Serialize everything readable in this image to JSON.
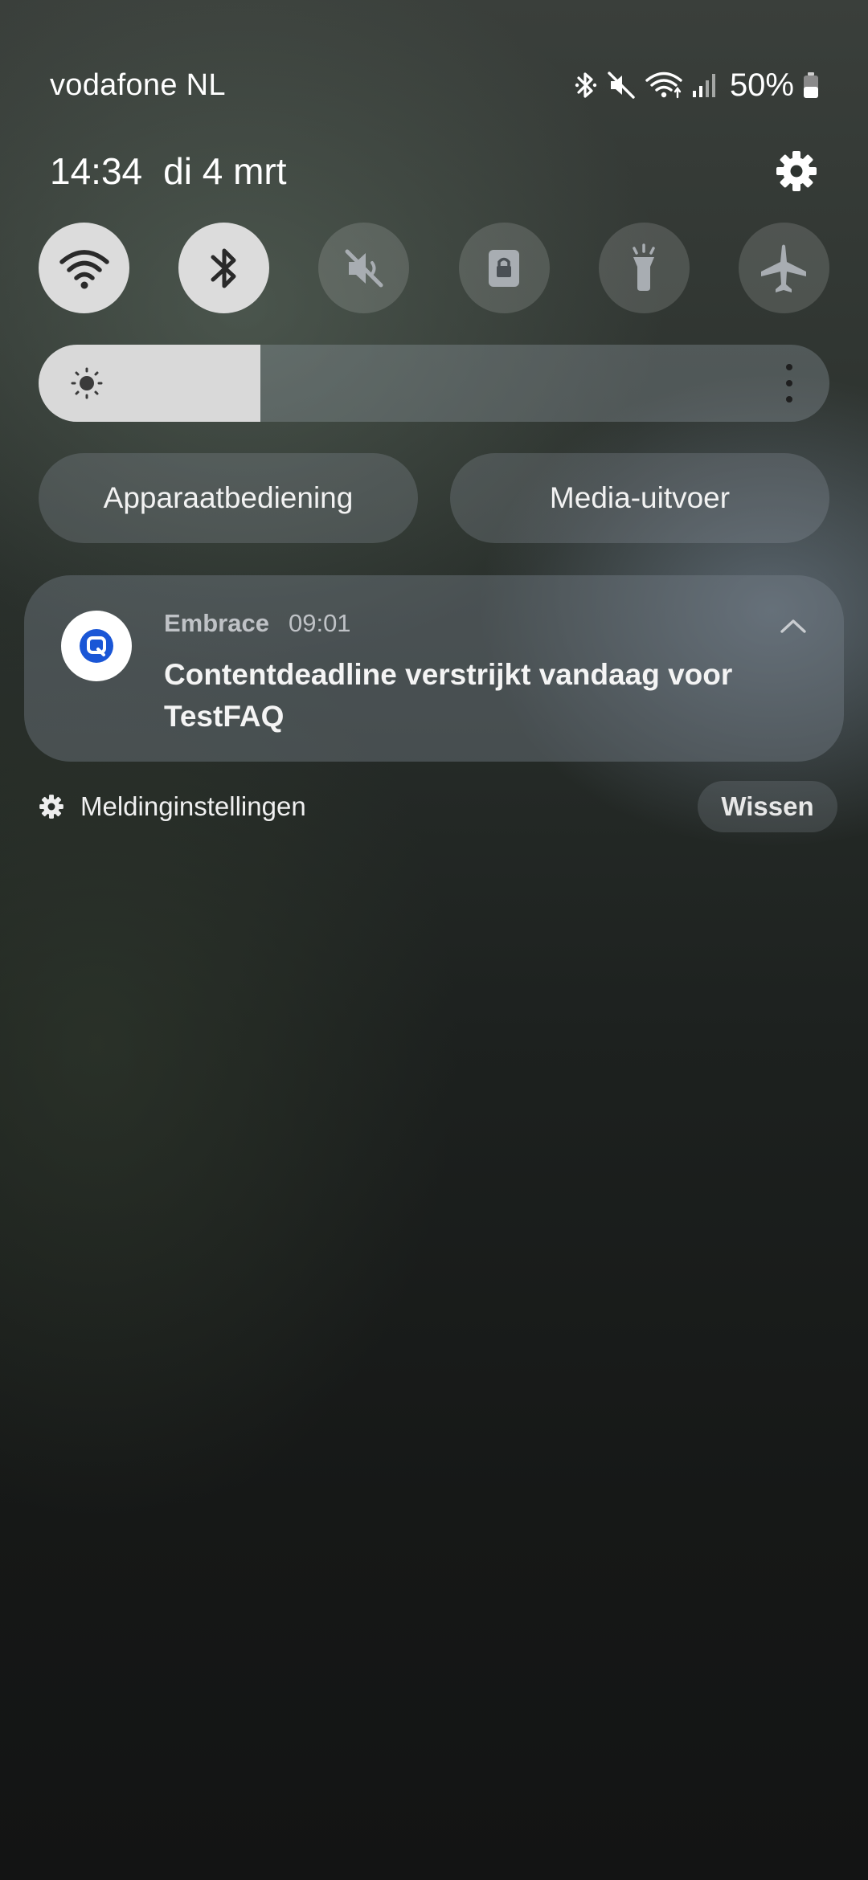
{
  "status_bar": {
    "carrier": "vodafone NL",
    "battery_percent": "50%",
    "icons": [
      "bluetooth-icon",
      "mute-icon",
      "wifi-icon",
      "signal-icon",
      "battery-icon"
    ],
    "battery_level": 0.5
  },
  "header": {
    "time": "14:34",
    "date": "di 4 mrt",
    "settings_icon": "gear-icon"
  },
  "quick_toggles": [
    {
      "name": "wifi",
      "icon": "wifi-icon",
      "state": "on"
    },
    {
      "name": "bluetooth",
      "icon": "bluetooth-icon",
      "state": "on"
    },
    {
      "name": "sound",
      "icon": "mute-icon",
      "state": "off"
    },
    {
      "name": "screen-lock",
      "icon": "lock-icon",
      "state": "off"
    },
    {
      "name": "flashlight",
      "icon": "flashlight-icon",
      "state": "off"
    },
    {
      "name": "airplane-mode",
      "icon": "airplane-icon",
      "state": "off"
    }
  ],
  "brightness": {
    "level": 0.28,
    "icon": "sun-icon",
    "more_icon": "more-vertical-icon"
  },
  "pills": {
    "device_control": "Apparaatbediening",
    "media_output": "Media-uitvoer"
  },
  "notification": {
    "app": "Embrace",
    "time": "09:01",
    "title": "Contentdeadline verstrijkt vandaag voor TestFAQ",
    "app_icon": "embrace-logo-icon",
    "app_icon_color": "#1a56d6",
    "collapse_icon": "chevron-up-icon"
  },
  "footer": {
    "settings_label": "Meldinginstellingen",
    "clear_label": "Wissen"
  },
  "colors": {
    "toggle_on": "#dcdcdc",
    "icon_on": "#2a2a2a",
    "icon_off": "#a8adb2"
  }
}
